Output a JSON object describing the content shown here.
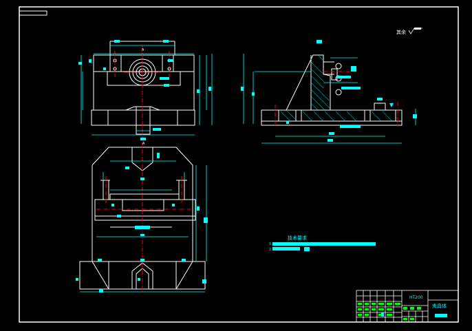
{
  "drawing": {
    "roughness_label": "其余",
    "technical_requirements_title": "技术要求",
    "technical_requirements": [
      {
        "index": "1."
      },
      {
        "index": "2."
      }
    ],
    "section_label_top": "A",
    "section_label_mid": "A",
    "title_block": {
      "material": "HT200",
      "part_name": "夹具体"
    }
  },
  "colors": {
    "background": "#000000",
    "lines": "#ffffff",
    "dimensions": "#00ffff",
    "centerlines": "#ff0000",
    "title_block_green": "#00ff00"
  }
}
